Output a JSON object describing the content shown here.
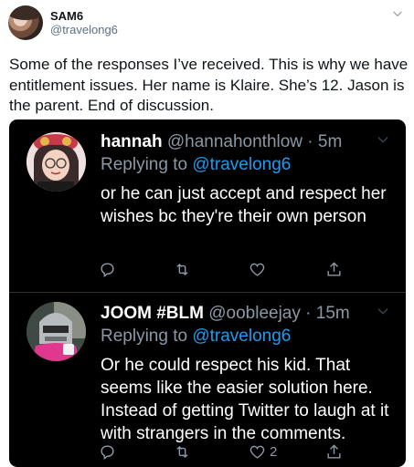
{
  "tweet": {
    "display_name": "SAM6",
    "handle": "@travelong6",
    "text": "Some of the responses I’ve received. This is why we have entitlement issues. Her name is Klaire. She’s 12. Jason is the parent. End of discussion."
  },
  "replies": [
    {
      "name": "hannah",
      "handle_time": "@hannahonthlow · 5m",
      "replying_prefix": "Replying to ",
      "replying_to": "@travelong6",
      "text": "or he can just accept and respect her wishes bc they're their own person",
      "like_count": ""
    },
    {
      "name": "JOOM #BLM",
      "handle_time": "@oobleejay · 15m",
      "replying_prefix": "Replying to ",
      "replying_to": "@travelong6",
      "text": "Or he could respect his kid. That seems like the easier solution here. Instead of getting Twitter to laugh at it with strangers in the comments.",
      "like_count": "2"
    }
  ],
  "icons": {
    "menu": "chevron-down-icon",
    "reply": "reply-icon",
    "retweet": "retweet-icon",
    "like": "heart-icon",
    "share": "share-icon"
  },
  "colors": {
    "link": "#1d9bf0",
    "card_bg": "#000000",
    "muted": "#8b98a5"
  }
}
